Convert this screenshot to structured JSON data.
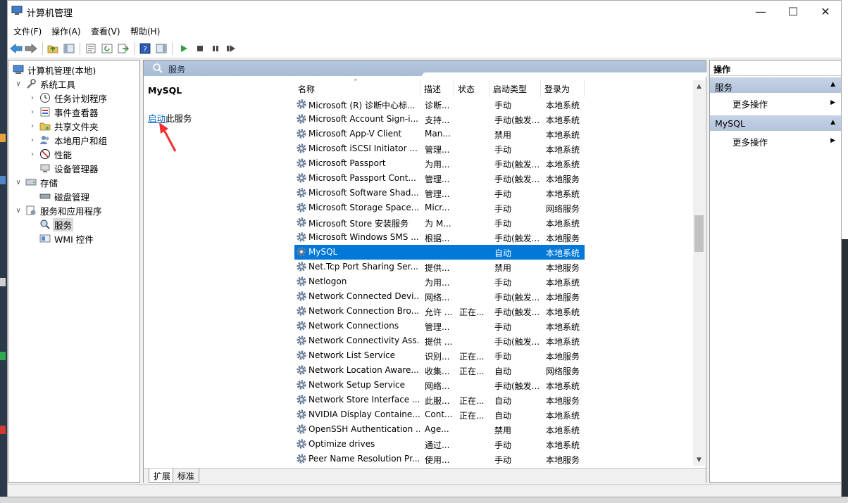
{
  "window": {
    "title": "计算机管理"
  },
  "menu": [
    "文件(F)",
    "操作(A)",
    "查看(V)",
    "帮助(H)"
  ],
  "tree": [
    {
      "label": "计算机管理(本地)",
      "level": 0,
      "expander": "",
      "icon": "computer-icon"
    },
    {
      "label": "系统工具",
      "level": 1,
      "expander": "v",
      "icon": "tools-icon"
    },
    {
      "label": "任务计划程序",
      "level": 2,
      "expander": ">",
      "icon": "clock-icon"
    },
    {
      "label": "事件查看器",
      "level": 2,
      "expander": ">",
      "icon": "event-viewer-icon"
    },
    {
      "label": "共享文件夹",
      "level": 2,
      "expander": ">",
      "icon": "shared-folder-icon"
    },
    {
      "label": "本地用户和组",
      "level": 2,
      "expander": ">",
      "icon": "users-icon"
    },
    {
      "label": "性能",
      "level": 2,
      "expander": ">",
      "icon": "performance-icon"
    },
    {
      "label": "设备管理器",
      "level": 2,
      "expander": "",
      "icon": "device-manager-icon"
    },
    {
      "label": "存储",
      "level": 1,
      "expander": "v",
      "icon": "storage-icon"
    },
    {
      "label": "磁盘管理",
      "level": 2,
      "expander": "",
      "icon": "disk-icon"
    },
    {
      "label": "服务和应用程序",
      "level": 1,
      "expander": "v",
      "icon": "services-apps-icon"
    },
    {
      "label": "服务",
      "level": 2,
      "expander": "",
      "icon": "services-icon",
      "selected": true
    },
    {
      "label": "WMI 控件",
      "level": 2,
      "expander": "",
      "icon": "wmi-icon"
    }
  ],
  "center": {
    "header": "服务",
    "selected_service": "MySQL",
    "start_link": "启动",
    "start_suffix": "此服务",
    "columns": [
      "名称",
      "描述",
      "状态",
      "启动类型",
      "登录为"
    ],
    "rows": [
      [
        "Microsoft (R) 诊断中心标...",
        "诊断...",
        "",
        "手动",
        "本地系统"
      ],
      [
        "Microsoft Account Sign-i...",
        "支持...",
        "",
        "手动(触发...",
        "本地系统"
      ],
      [
        "Microsoft App-V Client",
        "Man...",
        "",
        "禁用",
        "本地系统"
      ],
      [
        "Microsoft iSCSI Initiator ...",
        "管理...",
        "",
        "手动",
        "本地系统"
      ],
      [
        "Microsoft Passport",
        "为用...",
        "",
        "手动(触发...",
        "本地系统"
      ],
      [
        "Microsoft Passport Cont...",
        "管理...",
        "",
        "手动(触发...",
        "本地服务"
      ],
      [
        "Microsoft Software Shad...",
        "管理...",
        "",
        "手动",
        "本地系统"
      ],
      [
        "Microsoft Storage Space...",
        "Micr...",
        "",
        "手动",
        "网络服务"
      ],
      [
        "Microsoft Store 安装服务",
        "为 M...",
        "",
        "手动",
        "本地系统"
      ],
      [
        "Microsoft Windows SMS ...",
        "根据...",
        "",
        "手动(触发...",
        "本地服务"
      ],
      [
        "MySQL",
        "",
        "",
        "自动",
        "本地系统"
      ],
      [
        "Net.Tcp Port Sharing Ser...",
        "提供...",
        "",
        "禁用",
        "本地服务"
      ],
      [
        "Netlogon",
        "为用...",
        "",
        "手动",
        "本地系统"
      ],
      [
        "Network Connected Devi...",
        "网络...",
        "",
        "手动(触发...",
        "本地服务"
      ],
      [
        "Network Connection Bro...",
        "允许 ...",
        "正在...",
        "手动(触发...",
        "本地系统"
      ],
      [
        "Network Connections",
        "管理...",
        "",
        "手动",
        "本地系统"
      ],
      [
        "Network Connectivity Ass...",
        "提供 ...",
        "",
        "手动(触发...",
        "本地系统"
      ],
      [
        "Network List Service",
        "识别...",
        "正在...",
        "手动",
        "本地服务"
      ],
      [
        "Network Location Aware...",
        "收集...",
        "正在...",
        "自动",
        "网络服务"
      ],
      [
        "Network Setup Service",
        "网络...",
        "",
        "手动(触发...",
        "本地系统"
      ],
      [
        "Network Store Interface ...",
        "此服...",
        "正在...",
        "自动",
        "本地服务"
      ],
      [
        "NVIDIA Display Containe...",
        "Cont...",
        "正在...",
        "自动",
        "本地系统"
      ],
      [
        "OpenSSH Authentication ...",
        "Age...",
        "",
        "禁用",
        "本地系统"
      ],
      [
        "Optimize drives",
        "通过...",
        "",
        "手动",
        "本地系统"
      ],
      [
        "Peer Name Resolution Pr...",
        "使用...",
        "",
        "手动",
        "本地服务"
      ]
    ],
    "selected_row": 10,
    "tabs": [
      "扩展",
      "标准"
    ]
  },
  "actions": {
    "header": "操作",
    "sections": [
      {
        "title": "服务",
        "item": "更多操作"
      },
      {
        "title": "MySQL",
        "item": "更多操作"
      }
    ]
  }
}
